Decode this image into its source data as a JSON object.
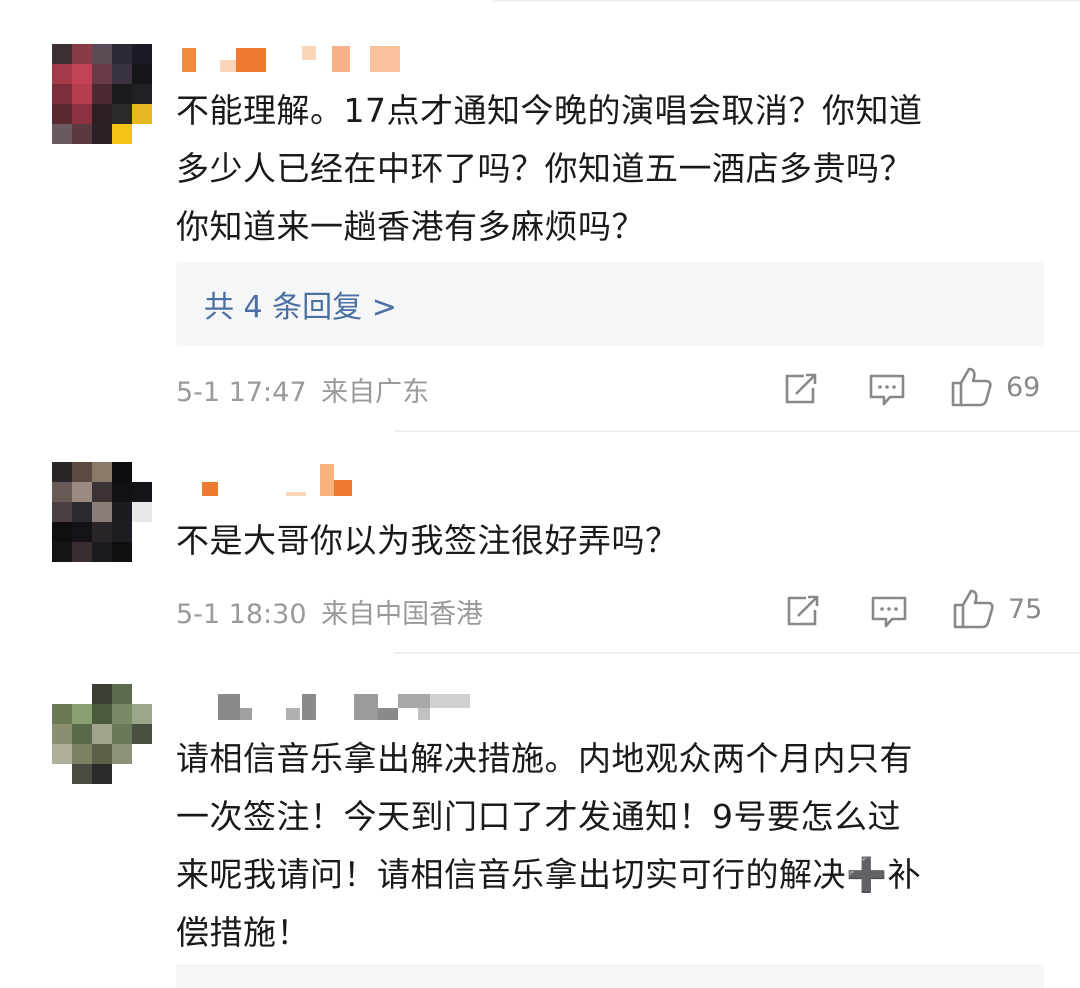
{
  "comments": [
    {
      "text": "不能理解。17点才通知今晚的演唱会取消？你知道多少人已经在中环了吗？你知道五一酒店多贵吗？你知道来一趟香港有多麻烦吗？",
      "lines": [
        "不能理解。17点才通知今晚的演唱会取消？你知道",
        "多少人已经在中环了吗？你知道五一酒店多贵吗？",
        "你知道来一趟香港有多麻烦吗？"
      ],
      "replies_label": "共 4 条回复 >",
      "time": "5-1 17:47",
      "location": "来自广东",
      "likes": "69"
    },
    {
      "text": "不是大哥你以为我签注很好弄吗？",
      "lines": [
        "不是大哥你以为我签注很好弄吗？"
      ],
      "time": "5-1 18:30",
      "location": "来自中国香港",
      "likes": "75"
    },
    {
      "text": "请相信音乐拿出解决措施。内地观众两个月内只有一次签注！今天到门口了才发通知！9号要怎么过来呢我请问！请相信音乐拿出切实可行的解决➕补偿措施！",
      "lines": [
        "请相信音乐拿出解决措施。内地观众两个月内只有",
        "一次签注！今天到门口了才发通知！9号要怎么过",
        "来呢我请问！请相信音乐拿出切实可行的解决➕补",
        "偿措施！"
      ]
    }
  ],
  "icons": {
    "repost": "repost-icon",
    "comment": "comment-icon",
    "like": "thumbs-up-icon"
  },
  "colors": {
    "reply_link": "#4a6fa0",
    "meta_text": "#9a9a9a",
    "reply_box_bg": "#f5f6f8"
  }
}
